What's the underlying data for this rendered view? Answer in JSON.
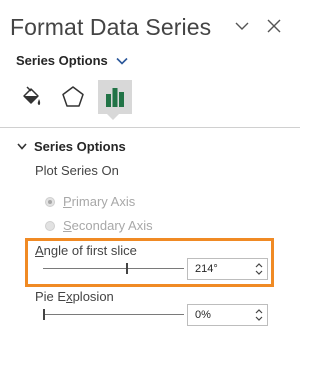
{
  "panel": {
    "title": "Format Data Series",
    "dropdown_label": "Series Options"
  },
  "tabs": [
    {
      "label": "Fill & Line",
      "icon": "paint-bucket-icon"
    },
    {
      "label": "Effects",
      "icon": "pentagon-icon"
    },
    {
      "label": "Series Options",
      "icon": "bar-chart-icon",
      "selected": true
    }
  ],
  "section": {
    "header": "Series Options",
    "plot_series_on_label": "Plot Series On",
    "primary_axis_label": "Primary Axis",
    "secondary_axis_label": "Secondary Axis",
    "primary_axis_selected": true,
    "axis_options_enabled": false
  },
  "angle": {
    "label": "Angle of first slice",
    "value": "214°",
    "slider_fraction": 0.594
  },
  "explosion": {
    "label": "Pie Explosion",
    "value": "0%",
    "slider_fraction": 0
  },
  "colors": {
    "highlight": "#f08a24",
    "accent": "#2b579a",
    "tab_icon_green": "#217346"
  }
}
